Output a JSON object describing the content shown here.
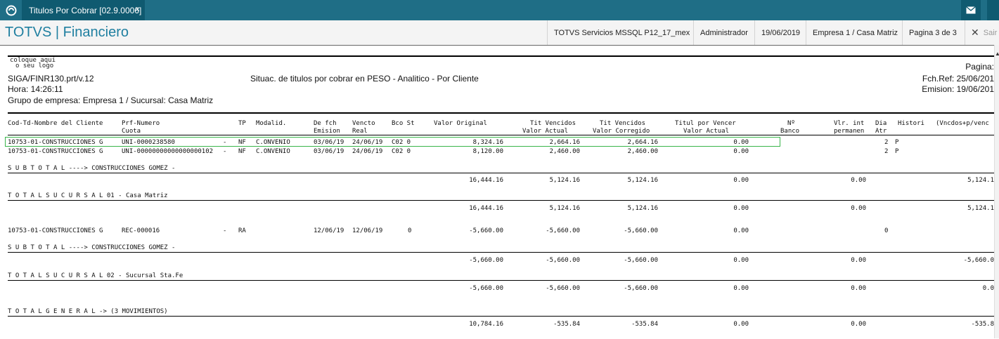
{
  "topbar": {
    "tab_title": "Titulos Por Cobrar [02.9.0006]",
    "tab_close": "×"
  },
  "header": {
    "app_title": "TOTVS | Financiero",
    "environment": "TOTVS Servicios MSSQL P12_17_mex",
    "user": "Administrador",
    "date": "19/06/2019",
    "company": "Empresa 1 / Casa Matriz",
    "page": "Pagina 3 de 3",
    "exit_label": "Sair"
  },
  "report": {
    "logo_text_1": "coloque aqui",
    "logo_text_2": "o seu logo",
    "pagina": "Pagina:",
    "program": "SIGA/FINR130.prt/v.12",
    "title": "Situac. de titulos por cobrar en PESO - Analitico - Por Cliente",
    "fch_ref": "Fch.Ref: 25/06/201",
    "hora": "Hora: 14:26:11",
    "emision": "Emision: 19/06/201",
    "grupo": "Grupo de empresa: Empresa 1 / Sucursal: Casa Matriz",
    "columns": {
      "c1": "Cod-Td-Nombre del Cliente",
      "c2a": "Prf-Numero",
      "c2b": "Cuota",
      "c3": "TP",
      "c4": "Modalid.",
      "c5a": "De fch",
      "c5b": "Emision",
      "c6a": "Vencto",
      "c6b": "Real",
      "c7": "Bco St",
      "c8": "Valor Original",
      "c9a": "Tit Vencidos",
      "c9b": "Valor Actual",
      "c10a": "Tit Vencidos",
      "c10b": "Valor Corregido",
      "c11a": "Titul por Vencer",
      "c11b": "Valor Actual",
      "c12a": "Nº",
      "c12b": "Banco",
      "c13a": "Vlr. int",
      "c13b": "permanen",
      "c14a": "Dia",
      "c14b": "Atr",
      "c15": "Histori",
      "c16": "(Vncdos+p/venc"
    },
    "rows": [
      {
        "cliente": "10753-01-CONSTRUCCIONES G",
        "numero": "UNI-0000238580",
        "dash": "-",
        "tp": "NF",
        "modalid": "C.ONVENIO",
        "emision": "03/06/19",
        "vencto": "24/06/19",
        "bco": "C02 0",
        "orig": "8,324.16",
        "venc_act": "2,664.16",
        "venc_corr": "2,664.16",
        "por_vencer": "0.00",
        "dia": "2",
        "hist": "P"
      },
      {
        "cliente": "10753-01-CONSTRUCCIONES G",
        "numero": "UNI-00000000000000000102",
        "dash": "-",
        "tp": "NF",
        "modalid": "C.ONVENIO",
        "emision": "03/06/19",
        "vencto": "24/06/19",
        "bco": "C02 0",
        "orig": "8,120.00",
        "venc_act": "2,460.00",
        "venc_corr": "2,460.00",
        "por_vencer": "0.00",
        "dia": "2",
        "hist": "P"
      },
      {
        "cliente": "10753-01-CONSTRUCCIONES G",
        "numero": "REC-000016",
        "dash": "-",
        "tp": "RA",
        "modalid": "",
        "emision": "12/06/19",
        "vencto": "12/06/19",
        "bco": "0",
        "orig": "-5,660.00",
        "venc_act": "-5,660.00",
        "venc_corr": "-5,660.00",
        "por_vencer": "0.00",
        "dia": "0",
        "hist": ""
      }
    ],
    "subtotal1": {
      "label": "S U B T O T A L    ----> CONSTRUCCIONES GOMEZ    -",
      "orig": "16,444.16",
      "a": "5,124.16",
      "b": "5,124.16",
      "c": "0.00",
      "d": "0.00",
      "e": "5,124.1"
    },
    "suc1": {
      "label": "T O T A L   S U C U R S A L 01 - Casa Matriz",
      "orig": "16,444.16",
      "a": "5,124.16",
      "b": "5,124.16",
      "c": "0.00",
      "d": "0.00",
      "e": "5,124.1"
    },
    "subtotal2": {
      "label": "S U B T O T A L    ----> CONSTRUCCIONES GOMEZ    -",
      "orig": "-5,660.00",
      "a": "-5,660.00",
      "b": "-5,660.00",
      "c": "0.00",
      "d": "0.00",
      "e": "-5,660.0"
    },
    "suc2": {
      "label": "T O T A L   S U C U R S A L 02 - Sucursal Sta.Fe",
      "orig": "-5,660.00",
      "a": "-5,660.00",
      "b": "-5,660.00",
      "c": "0.00",
      "d": "0.00",
      "e": "0.0"
    },
    "general": {
      "label": "T O T A L   G E N E R A L -> (3 MOVIMIENTOS)",
      "orig": "10,784.16",
      "a": "-535.84",
      "b": "-535.84",
      "c": "0.00",
      "d": "0.00",
      "e": "-535.8"
    }
  }
}
